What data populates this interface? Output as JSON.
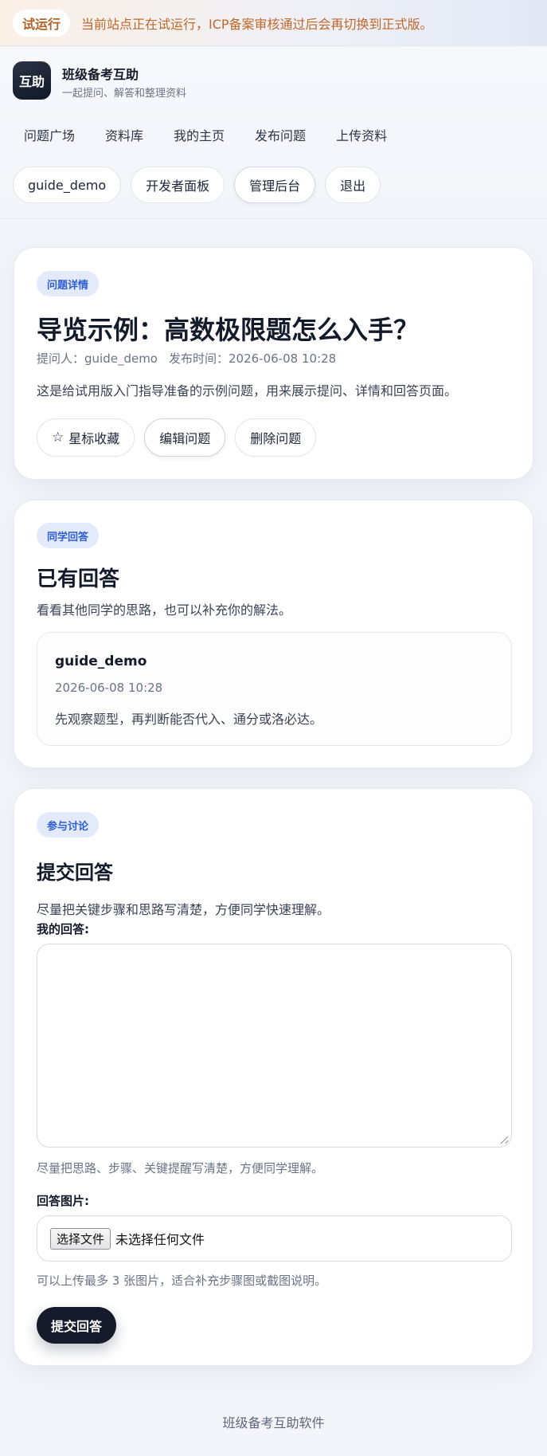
{
  "banner": {
    "pill": "试运行",
    "text": "当前站点正在试运行，ICP备案审核通过后会再切换到正式版。"
  },
  "brand": {
    "logo_text": "互助",
    "name": "班级备考互助",
    "subtitle": "一起提问、解答和整理资料"
  },
  "nav": {
    "items": [
      "问题广场",
      "资料库",
      "我的主页",
      "发布问题",
      "上传资料"
    ]
  },
  "user_chips": {
    "username": "guide_demo",
    "dev_panel": "开发者面板",
    "admin": "管理后台",
    "logout": "退出"
  },
  "question": {
    "tag": "问题详情",
    "title": "导览示例：高数极限题怎么入手？",
    "asker": "提问人：guide_demo",
    "posted": "发布时间：2026-06-08 10:28",
    "description": "这是给试用版入门指导准备的示例问题，用来展示提问、详情和回答页面。",
    "star_icon": "star-outline-icon",
    "star_label": "星标收藏",
    "edit_label": "编辑问题",
    "delete_label": "删除问题"
  },
  "answers": {
    "tag": "同学回答",
    "title": "已有回答",
    "subtitle": "看看其他同学的思路，也可以补充你的解法。",
    "items": [
      {
        "user": "guide_demo",
        "time": "2026-06-08 10:28",
        "text": "先观察题型，再判断能否代入、通分或洛必达。"
      }
    ]
  },
  "reply_form": {
    "tag": "参与讨论",
    "title": "提交回答",
    "subtitle": "尽量把关键步骤和思路写清楚，方便同学快速理解。",
    "answer_label": "我的回答:",
    "answer_value": "",
    "answer_hint": "尽量把思路、步骤、关键提醒写清楚，方便同学理解。",
    "image_label": "回答图片:",
    "file_button": "选择文件",
    "file_status": "未选择任何文件",
    "image_hint": "可以上传最多 3 张图片，适合补充步骤图或截图说明。",
    "submit_label": "提交回答"
  },
  "footer": {
    "text": "班级备考互助软件"
  }
}
